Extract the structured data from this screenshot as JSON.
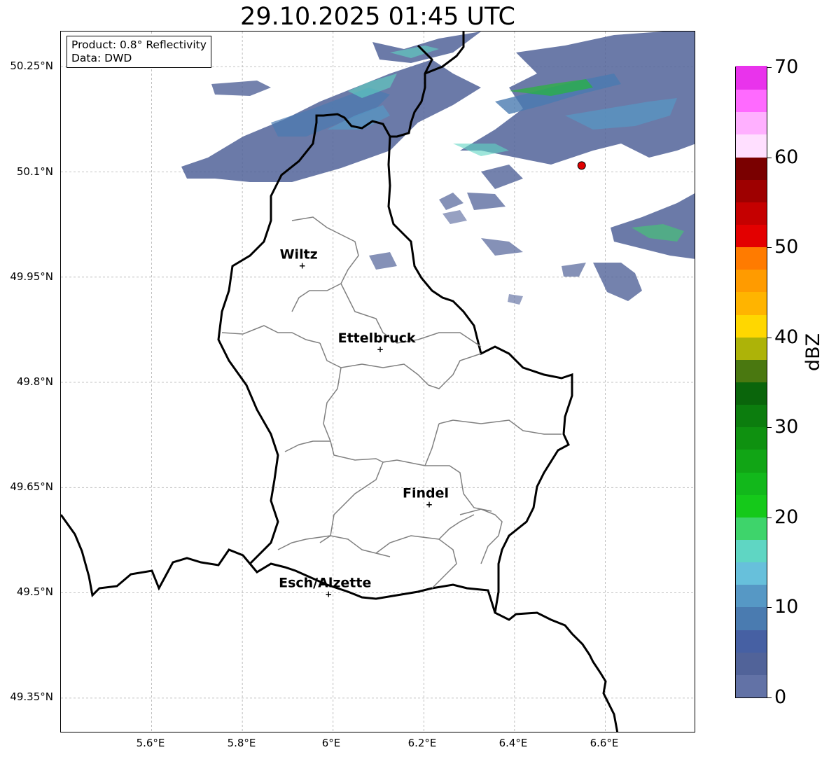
{
  "title": "29.10.2025 01:45 UTC",
  "info": {
    "product": "Product: 0.8° Reflectivity",
    "source": "Data: DWD"
  },
  "axes": {
    "x_ticks": [
      "5.6°E",
      "5.8°E",
      "6°E",
      "6.2°E",
      "6.4°E",
      "6.6°E"
    ],
    "y_ticks": [
      "50.25°N",
      "50.1°N",
      "49.95°N",
      "49.8°N",
      "49.65°N",
      "49.5°N",
      "49.35°N"
    ],
    "x_range": [
      5.4,
      6.8
    ],
    "y_range": [
      49.3,
      50.3
    ],
    "grid": true
  },
  "colorbar": {
    "label": "dBZ",
    "ticks": [
      "70",
      "60",
      "50",
      "40",
      "30",
      "20",
      "10",
      "0"
    ],
    "range": [
      0,
      70
    ],
    "colors": [
      "#6272a6",
      "#516399",
      "#4660a3",
      "#4a7bb0",
      "#5698c5",
      "#67c0db",
      "#5fd6c3",
      "#3ed46b",
      "#15c91a",
      "#12b81b",
      "#11a515",
      "#0f9110",
      "#0c7d0e",
      "#0a650b",
      "#4a7810",
      "#adb308",
      "#ffd700",
      "#ffb400",
      "#ff9b00",
      "#ff7b00",
      "#e30000",
      "#c50000",
      "#9e0000",
      "#7a0000",
      "#ffdfff",
      "#ffb0ff",
      "#ff6aff",
      "#e933ec"
    ]
  },
  "cities": [
    {
      "name": "Wiltz",
      "lon": 5.932,
      "lat": 49.966
    },
    {
      "name": "Ettelbruck",
      "lon": 6.104,
      "lat": 49.847
    },
    {
      "name": "Findel",
      "lon": 6.212,
      "lat": 49.626
    },
    {
      "name": "Esch/Alzette",
      "lon": 5.99,
      "lat": 49.498
    }
  ],
  "radar_site": {
    "lon": 6.548,
    "lat": 50.109,
    "color": "#e00000"
  }
}
